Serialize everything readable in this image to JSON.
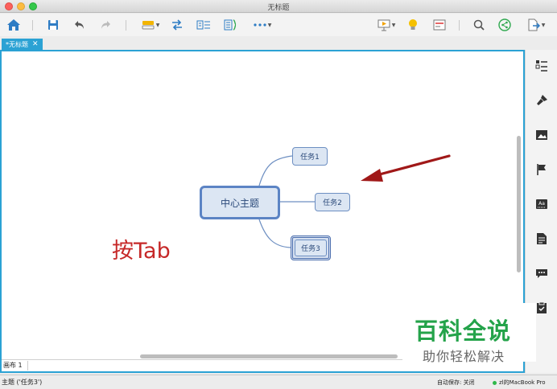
{
  "window": {
    "title": "无标题"
  },
  "toolbar": {
    "items": [
      "home-icon",
      "save-icon",
      "undo-icon",
      "redo-icon",
      "topic-insert-icon",
      "relationship-icon",
      "summary-icon",
      "boundary-icon",
      "more-icon",
      "presentation-icon",
      "idea-icon",
      "outline-icon",
      "search-icon",
      "share-icon",
      "export-icon"
    ]
  },
  "tab": {
    "label": "*无标题",
    "close": "✕"
  },
  "mindmap": {
    "central": "中心主题",
    "topics": [
      "任务1",
      "任务2",
      "任务3"
    ],
    "selected": "任务3"
  },
  "annotation": {
    "text": "按Tab"
  },
  "sheet": {
    "label": "画布 1"
  },
  "status": {
    "left": "主题 ('任务3')",
    "autosave": "自动保存: 关闭",
    "user": "zl的MacBook Pro"
  },
  "watermark": {
    "main": "百科全说",
    "sub": "助你轻松解决"
  },
  "colors": {
    "accent": "#2ba2d4",
    "arrow": "#a01818",
    "annotation": "#c62828",
    "node_fill": "#dce6f3",
    "node_border": "#5c84c4"
  }
}
